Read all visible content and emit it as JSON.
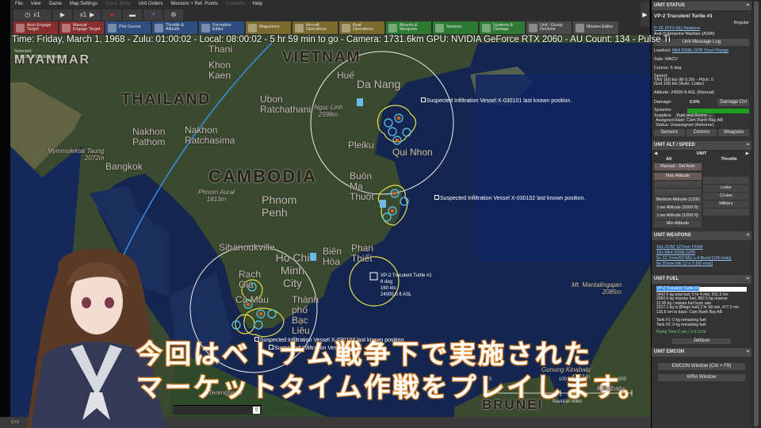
{
  "menu": [
    "File",
    "View",
    "Game",
    "Map Settings",
    "Quick Jump",
    "Unit Orders",
    "Missions + Ref. Points",
    "Contacts",
    "Help"
  ],
  "menu_disabled": [
    "Quick Jump",
    "Contacts"
  ],
  "toolbar": {
    "time_compression": "x1",
    "play_speed": "x1"
  },
  "commands": [
    {
      "label": "Auto Engage Target",
      "group": "red"
    },
    {
      "label": "Manual Engage Target",
      "group": "red"
    },
    {
      "label": "Plot Course",
      "group": "blue"
    },
    {
      "label": "Throttle & Altitude",
      "group": "blue"
    },
    {
      "label": "Formation Editor",
      "group": "blue"
    },
    {
      "label": "Magazines",
      "group": "olive"
    },
    {
      "label": "Aircraft Operations",
      "group": "olive"
    },
    {
      "label": "Boat Operations",
      "group": "olive"
    },
    {
      "label": "Mounts & Weapons",
      "group": "green"
    },
    {
      "label": "Sensors",
      "group": "green"
    },
    {
      "label": "Systems & Damage",
      "group": "green"
    },
    {
      "label": "Unit / Group Doctrine",
      "group": "grey"
    },
    {
      "label": "Mission Editor",
      "group": "grey"
    }
  ],
  "status_line": "Time: Friday, March 1, 1968 - Zulu: 01:00:02 - Local: 08:00:02 - 5 hr 59 min to go - Camera: 1731.6km GPU: NVIDIA GeForce RTX 2060 - AU Count: 134 - Pulse Ti",
  "selected": {
    "label": "Selected:",
    "unit": "1x P-2E (P2V-6E) Neptune"
  },
  "map": {
    "countries": [
      "MYANMAR",
      "THAILAND",
      "CAMBODIA",
      "VIETNAM",
      "BRUNEI"
    ],
    "cities": [
      "Khon Kaen",
      "Thani",
      "Nakhon Pathom",
      "Nakhon Ratchasima",
      "Bangkok",
      "Ubon Ratchathani",
      "Phnom Penh",
      "Sihanoukville",
      "Ho Chi Minh City",
      "Biên Hòa",
      "Huế",
      "Da Nang",
      "Pleiku",
      "Qui Nhon",
      "Buôn Ma Thuột",
      "Phan Thiết",
      "Rạch Giá",
      "Cà Mau",
      "Thành phố Bạc Liêu",
      "Terengganu",
      "Kinabalu"
    ],
    "peaks": [
      {
        "name": "Myinmolektat Taung",
        "height": "2072m"
      },
      {
        "name": "Phnom Aural",
        "height": "1813m"
      },
      {
        "name": "Ngọc Linh",
        "height": "2598m"
      },
      {
        "name": "Mt. Mantalingajan",
        "height": "2085m"
      },
      {
        "name": "Gunung Kinabalu",
        "height": "4101m"
      }
    ],
    "contacts": [
      "Suspected Infiltration Vessel X-030101 last known position.",
      "Suspected Infiltration Vessel X-030102 last known position.",
      "Suspected Infiltration Vessel X-030103 last known position.",
      "Suspected Infiltration Vessel X"
    ],
    "unit_label": {
      "name": "VP-2 Truculent Turtle #1",
      "course": "6 deg",
      "speed": "160 kts",
      "altitude": "24000.0 ft ASL"
    },
    "scale": {
      "ticks": [
        "0",
        "100",
        "200"
      ],
      "unit": "Nautical miles"
    }
  },
  "subtitle": [
    "今回はベトナム戦争下で実施された",
    "マーケットタイム作戦をプレイします。"
  ],
  "bottom": {
    "left": "Gro",
    "mid": "min"
  },
  "panel": {
    "unit_status": {
      "title": "UNIT STATUS",
      "name": "VP-2 Truculent Turtle #1",
      "proficiency": "Regular",
      "type": "P-2E (P2V-6E) Neptune",
      "role": "Anti-Submarine Warfare (ASW)",
      "message_log": "Unit Message Log",
      "loadout_label": "Loadout:",
      "loadout": "Mk4 500lb GPB Short-Range",
      "side": "Side: MACV",
      "course": "Course: 6 deg",
      "speed_label": "Speed:",
      "tas": "TAS 160 kts (M 0.26) - Pitch: 0",
      "gnd": "Gnd 160 kts (Auto: Loiter)",
      "altitude": "Altitude: 24000 ft ASL (Manual)",
      "damage_label": "Damage:",
      "damage": "0.0%",
      "damage_ctrl": "Damage Ctrl",
      "systems": "Systems:",
      "systems_health": 1.0,
      "supplies_label": "Supplies:",
      "supplies": "Fuel and Ammo",
      "base": "Assigned base: Cam Ranh Bay AB",
      "status": "Status: Unassigned (Airborne)",
      "buttons": [
        "Sensors",
        "Comms",
        "Weapons"
      ]
    },
    "alt_speed": {
      "title": "UNIT ALT / SPEED",
      "unit": "UNIT",
      "alt": "Alt",
      "throttle": "Throttle",
      "manual": "Manual - Set Auto",
      "alt_buttons": [
        "Max Altitude",
        "High Altitude (36000 ft)",
        "High Altitude (25000 ft)",
        "Medium Altitude (1200",
        "Low Altitude (2000 ft)",
        "Low Altitude (1000 ft)",
        "Min Altitude"
      ],
      "throttle_buttons": [
        "Flank",
        "Loiter",
        "Cruise",
        "Military",
        "Afterburner"
      ]
    },
    "weapons": {
      "title": "UNIT WEAPONS",
      "items": [
        "16x ZUNI 127mm FFAR",
        "16x Mk4 500lb GPB",
        "5x 12.7mm/50 MG x 4 Burst [100 rnds]",
        "8x 20mm Mk 12 x 2 [50 rnds]"
      ]
    },
    "fuel": {
      "title": "UNIT FUEL",
      "selected": "VP-2 Truculent Turtle #1",
      "lines": [
        "3942.6 kg total fuel; 5 hr 4 min, 811.9 nm",
        "3060.6 kg mission fuel, 882.0 kg reserve",
        "12.95 kg / minute fuel burn rate",
        "2317.1 kg to [Bingo fuel] 2 hr 58 min, 477.2 nm",
        "133.6 nm to base: Cam Ranh Bay AB"
      ],
      "tanks": [
        "Tank #1: 0 kg remaining fuel",
        "Tank #2: 0 kg remaining fuel"
      ],
      "flying_time": "Flying Time:2 sec / 2 d 19 hr",
      "jettison": "Jettison"
    },
    "emcon": {
      "title": "UNIT EMCON",
      "buttons": [
        "EMCON Window (Ctrl + F9)",
        "WRA Window"
      ]
    }
  }
}
